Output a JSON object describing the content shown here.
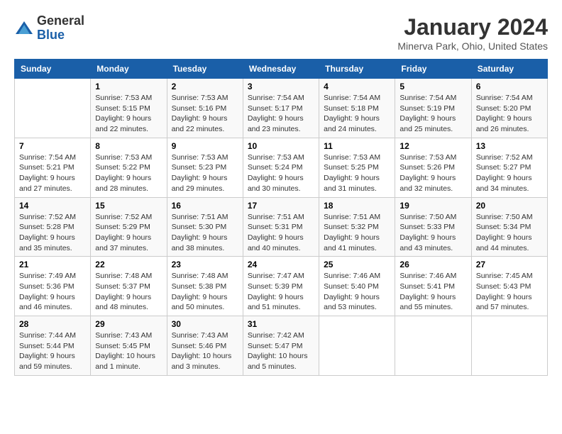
{
  "logo": {
    "general": "General",
    "blue": "Blue"
  },
  "header": {
    "title": "January 2024",
    "subtitle": "Minerva Park, Ohio, United States"
  },
  "days_of_week": [
    "Sunday",
    "Monday",
    "Tuesday",
    "Wednesday",
    "Thursday",
    "Friday",
    "Saturday"
  ],
  "weeks": [
    [
      {
        "day": "",
        "info": ""
      },
      {
        "day": "1",
        "info": "Sunrise: 7:53 AM\nSunset: 5:15 PM\nDaylight: 9 hours\nand 22 minutes."
      },
      {
        "day": "2",
        "info": "Sunrise: 7:53 AM\nSunset: 5:16 PM\nDaylight: 9 hours\nand 22 minutes."
      },
      {
        "day": "3",
        "info": "Sunrise: 7:54 AM\nSunset: 5:17 PM\nDaylight: 9 hours\nand 23 minutes."
      },
      {
        "day": "4",
        "info": "Sunrise: 7:54 AM\nSunset: 5:18 PM\nDaylight: 9 hours\nand 24 minutes."
      },
      {
        "day": "5",
        "info": "Sunrise: 7:54 AM\nSunset: 5:19 PM\nDaylight: 9 hours\nand 25 minutes."
      },
      {
        "day": "6",
        "info": "Sunrise: 7:54 AM\nSunset: 5:20 PM\nDaylight: 9 hours\nand 26 minutes."
      }
    ],
    [
      {
        "day": "7",
        "info": "Sunrise: 7:54 AM\nSunset: 5:21 PM\nDaylight: 9 hours\nand 27 minutes."
      },
      {
        "day": "8",
        "info": "Sunrise: 7:53 AM\nSunset: 5:22 PM\nDaylight: 9 hours\nand 28 minutes."
      },
      {
        "day": "9",
        "info": "Sunrise: 7:53 AM\nSunset: 5:23 PM\nDaylight: 9 hours\nand 29 minutes."
      },
      {
        "day": "10",
        "info": "Sunrise: 7:53 AM\nSunset: 5:24 PM\nDaylight: 9 hours\nand 30 minutes."
      },
      {
        "day": "11",
        "info": "Sunrise: 7:53 AM\nSunset: 5:25 PM\nDaylight: 9 hours\nand 31 minutes."
      },
      {
        "day": "12",
        "info": "Sunrise: 7:53 AM\nSunset: 5:26 PM\nDaylight: 9 hours\nand 32 minutes."
      },
      {
        "day": "13",
        "info": "Sunrise: 7:52 AM\nSunset: 5:27 PM\nDaylight: 9 hours\nand 34 minutes."
      }
    ],
    [
      {
        "day": "14",
        "info": "Sunrise: 7:52 AM\nSunset: 5:28 PM\nDaylight: 9 hours\nand 35 minutes."
      },
      {
        "day": "15",
        "info": "Sunrise: 7:52 AM\nSunset: 5:29 PM\nDaylight: 9 hours\nand 37 minutes."
      },
      {
        "day": "16",
        "info": "Sunrise: 7:51 AM\nSunset: 5:30 PM\nDaylight: 9 hours\nand 38 minutes."
      },
      {
        "day": "17",
        "info": "Sunrise: 7:51 AM\nSunset: 5:31 PM\nDaylight: 9 hours\nand 40 minutes."
      },
      {
        "day": "18",
        "info": "Sunrise: 7:51 AM\nSunset: 5:32 PM\nDaylight: 9 hours\nand 41 minutes."
      },
      {
        "day": "19",
        "info": "Sunrise: 7:50 AM\nSunset: 5:33 PM\nDaylight: 9 hours\nand 43 minutes."
      },
      {
        "day": "20",
        "info": "Sunrise: 7:50 AM\nSunset: 5:34 PM\nDaylight: 9 hours\nand 44 minutes."
      }
    ],
    [
      {
        "day": "21",
        "info": "Sunrise: 7:49 AM\nSunset: 5:36 PM\nDaylight: 9 hours\nand 46 minutes."
      },
      {
        "day": "22",
        "info": "Sunrise: 7:48 AM\nSunset: 5:37 PM\nDaylight: 9 hours\nand 48 minutes."
      },
      {
        "day": "23",
        "info": "Sunrise: 7:48 AM\nSunset: 5:38 PM\nDaylight: 9 hours\nand 50 minutes."
      },
      {
        "day": "24",
        "info": "Sunrise: 7:47 AM\nSunset: 5:39 PM\nDaylight: 9 hours\nand 51 minutes."
      },
      {
        "day": "25",
        "info": "Sunrise: 7:46 AM\nSunset: 5:40 PM\nDaylight: 9 hours\nand 53 minutes."
      },
      {
        "day": "26",
        "info": "Sunrise: 7:46 AM\nSunset: 5:41 PM\nDaylight: 9 hours\nand 55 minutes."
      },
      {
        "day": "27",
        "info": "Sunrise: 7:45 AM\nSunset: 5:43 PM\nDaylight: 9 hours\nand 57 minutes."
      }
    ],
    [
      {
        "day": "28",
        "info": "Sunrise: 7:44 AM\nSunset: 5:44 PM\nDaylight: 9 hours\nand 59 minutes."
      },
      {
        "day": "29",
        "info": "Sunrise: 7:43 AM\nSunset: 5:45 PM\nDaylight: 10 hours\nand 1 minute."
      },
      {
        "day": "30",
        "info": "Sunrise: 7:43 AM\nSunset: 5:46 PM\nDaylight: 10 hours\nand 3 minutes."
      },
      {
        "day": "31",
        "info": "Sunrise: 7:42 AM\nSunset: 5:47 PM\nDaylight: 10 hours\nand 5 minutes."
      },
      {
        "day": "",
        "info": ""
      },
      {
        "day": "",
        "info": ""
      },
      {
        "day": "",
        "info": ""
      }
    ]
  ]
}
